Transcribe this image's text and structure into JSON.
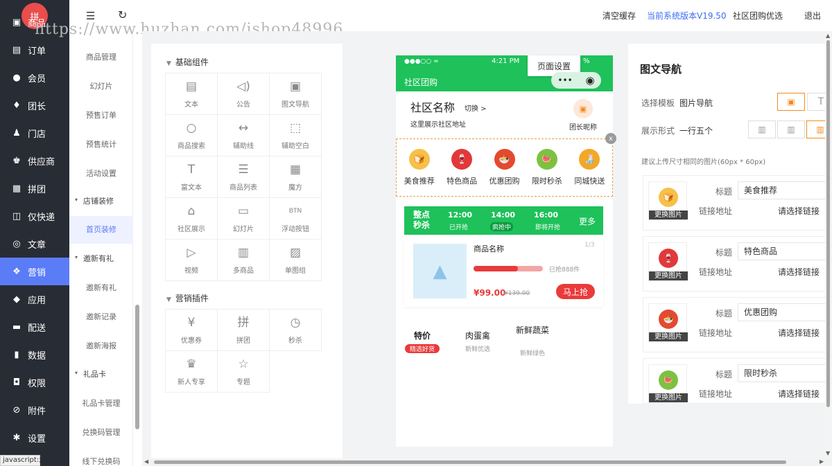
{
  "logo": {
    "glyph": "拼"
  },
  "watermark": "https://www.huzhan.com/ishop48996",
  "topbar": {
    "clear_cache": "清空缓存",
    "version": "当前系统版本V19.50",
    "brand": "社区团购优选",
    "logout": "退出"
  },
  "sidebar": {
    "items": [
      {
        "label": "商品",
        "icon": "box-icon"
      },
      {
        "label": "订单",
        "icon": "document-icon"
      },
      {
        "label": "会员",
        "icon": "user-icon"
      },
      {
        "label": "团长",
        "icon": "leader-icon"
      },
      {
        "label": "门店",
        "icon": "store-icon"
      },
      {
        "label": "供应商",
        "icon": "supplier-icon"
      },
      {
        "label": "拼团",
        "icon": "group-icon"
      },
      {
        "label": "仅快递",
        "icon": "express-icon"
      },
      {
        "label": "文章",
        "icon": "compass-icon"
      },
      {
        "label": "营销",
        "icon": "gift-icon"
      },
      {
        "label": "应用",
        "icon": "cube-icon"
      },
      {
        "label": "配送",
        "icon": "truck-icon"
      },
      {
        "label": "数据",
        "icon": "chart-icon"
      },
      {
        "label": "权限",
        "icon": "lock-icon"
      },
      {
        "label": "附件",
        "icon": "paperclip-icon"
      },
      {
        "label": "设置",
        "icon": "gear-icon"
      }
    ]
  },
  "subnav": {
    "items": [
      "商品管理",
      "幻灯片",
      "预售订单",
      "预售统计",
      "活动设置"
    ],
    "group_shop": "店铺装修",
    "active": "首页装修",
    "group_invite": "邀新有礼",
    "invite_items": [
      "邀新有礼",
      "邀新记录",
      "邀新海报"
    ],
    "group_gift": "礼品卡",
    "gift_items": [
      "礼品卡管理",
      "兑换码管理",
      "线下兑换码"
    ]
  },
  "components": {
    "basic_title": "基础组件",
    "basic": [
      {
        "label": "文本",
        "icon": "text-icon",
        "glyph": "▤"
      },
      {
        "label": "公告",
        "icon": "speaker-icon",
        "glyph": "◁)"
      },
      {
        "label": "图文导航",
        "icon": "image-nav-icon",
        "glyph": "▣"
      },
      {
        "label": "商品搜索",
        "icon": "search-icon",
        "glyph": "○"
      },
      {
        "label": "辅助线",
        "icon": "divider-icon",
        "glyph": "↔"
      },
      {
        "label": "辅助空白",
        "icon": "blank-icon",
        "glyph": "⬚"
      },
      {
        "label": "富文本",
        "icon": "richtext-icon",
        "glyph": "T"
      },
      {
        "label": "商品列表",
        "icon": "list-icon",
        "glyph": "☰"
      },
      {
        "label": "魔方",
        "icon": "cube-layout-icon",
        "glyph": "▦"
      },
      {
        "label": "社区展示",
        "icon": "shop-icon",
        "glyph": "⌂"
      },
      {
        "label": "幻灯片",
        "icon": "slides-icon",
        "glyph": "▭"
      },
      {
        "label": "浮动按钮",
        "icon": "float-button-icon",
        "glyph": "BTN"
      },
      {
        "label": "视频",
        "icon": "play-icon",
        "glyph": "▷"
      },
      {
        "label": "多商品",
        "icon": "multi-goods-icon",
        "glyph": "▥"
      },
      {
        "label": "单图组",
        "icon": "picture-icon",
        "glyph": "▨"
      }
    ],
    "marketing_title": "营销插件",
    "marketing": [
      {
        "label": "优惠券",
        "icon": "coupon-icon",
        "glyph": "¥"
      },
      {
        "label": "拼团",
        "icon": "bag-icon",
        "glyph": "拼"
      },
      {
        "label": "秒杀",
        "icon": "clock-icon",
        "glyph": "◷"
      },
      {
        "label": "新人专享",
        "icon": "crown-icon",
        "glyph": "♛"
      },
      {
        "label": "专题",
        "icon": "star-badge-icon",
        "glyph": "☆"
      }
    ]
  },
  "phone": {
    "status_left": "●●●○○ ≈",
    "status_time": "4:21 PM",
    "status_right": "%",
    "app_title": "社区团购",
    "page_setting": "页面设置",
    "capsule_dots": "•••",
    "capsule_target": "◉",
    "community_name": "社区名称",
    "switch": "切换 >",
    "address": "这里展示社区地址",
    "leader_nick": "团长昵称",
    "close": "x",
    "nav_items": [
      {
        "label": "美食推荐",
        "color": "#f6c04a",
        "glyph": "🍞"
      },
      {
        "label": "特色商品",
        "color": "#e2383a",
        "glyph": "🍷"
      },
      {
        "label": "优惠团购",
        "color": "#e44a2f",
        "glyph": "🍜"
      },
      {
        "label": "限时秒杀",
        "color": "#7cc242",
        "glyph": "🍉"
      },
      {
        "label": "同城快送",
        "color": "#f3a728",
        "glyph": "🍶"
      }
    ],
    "flash": {
      "title1": "整点",
      "title2": "秒杀",
      "slots": [
        {
          "time": "12:00",
          "state": "已开抢"
        },
        {
          "time": "14:00",
          "state": "疯抢中"
        },
        {
          "time": "16:00",
          "state": "即将开抢"
        }
      ],
      "more": "更多"
    },
    "product": {
      "name": "商品名称",
      "page": "1/3",
      "sold": "已抢888件",
      "price": "¥99.00",
      "old_price": "¥139.00",
      "buy": "马上抢",
      "progress": 0.64
    },
    "tabs": [
      {
        "title": "特价",
        "sub": "精选好货"
      },
      {
        "title": "肉蛋禽",
        "sub": "新鲜优选"
      },
      {
        "title": "新鲜蔬菜",
        "sub": "新鲜绿色"
      }
    ]
  },
  "props": {
    "title": "图文导航",
    "template_label": "选择模板",
    "template_value": "图片导航",
    "style_label": "展示形式",
    "style_value": "一行五个",
    "hint": "建议上传尺寸相同的图片(60px * 60px)",
    "title_label": "标题",
    "link_label": "链接地址",
    "change_img": "更换图片",
    "choose_link": "请选择链接",
    "items": [
      "美食推荐",
      "特色商品",
      "优惠团购",
      "限时秒杀"
    ],
    "accent": "#f38a1e"
  },
  "status_text": "javascript:;"
}
